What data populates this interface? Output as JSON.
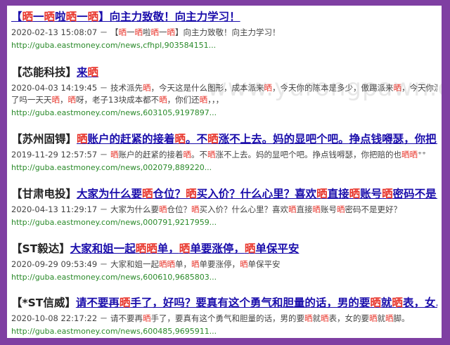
{
  "watermark": "www.yurongpawn.com",
  "results": [
    {
      "tag": "",
      "title": [
        [
          "【"
        ],
        [
          "晒",
          1
        ],
        [
          "一"
        ],
        [
          "晒",
          1
        ],
        [
          "啦"
        ],
        [
          "晒",
          1
        ],
        [
          "一"
        ],
        [
          "晒",
          1
        ],
        [
          "】向主力致敬！向主力学习！"
        ]
      ],
      "snippet": [
        [
          "2020-02-13 15:08:07 － 【"
        ],
        [
          "晒",
          1
        ],
        [
          "一"
        ],
        [
          "晒",
          1
        ],
        [
          "啦"
        ],
        [
          "晒",
          1
        ],
        [
          "一"
        ],
        [
          "晒",
          1
        ],
        [
          "】向主力致敬！向主力学习！"
        ]
      ],
      "url": "http://guba.eastmoney.com/news,cfhpl,903584151...",
      "title_text": "【晒一晒啦晒一晒】向主力致敬！向主力学习！",
      "snippet_text": "2020-02-13 15:08:07 － 【晒一晒啦晒一晒】向主力致敬！向主力学习！"
    },
    {
      "tag": "【芯能科技】",
      "title": [
        [
          "来"
        ],
        [
          "晒",
          1
        ]
      ],
      "snippet": [
        [
          "2020-04-03 14:19:45 － 技术派先"
        ],
        [
          "晒",
          1
        ],
        [
          "，今天这是什么图形，成本派来"
        ],
        [
          "晒",
          1
        ],
        [
          "，今天你的陈本是多少，傲踢派来"
        ],
        [
          "晒",
          1
        ],
        [
          "，今天你湿"
        ]
      ],
      "snippet2": [
        [
          "了吗一天天"
        ],
        [
          "晒",
          1
        ],
        [
          "，"
        ],
        [
          "晒",
          1
        ],
        [
          "呀，老子13块成本都不"
        ],
        [
          "晒",
          1
        ],
        [
          "，你们还"
        ],
        [
          "晒",
          1
        ],
        [
          "，，，"
        ]
      ],
      "url": "http://guba.eastmoney.com/news,603105,9197897...",
      "title_text": "来晒",
      "snippet_text": "2020-04-03 14:19:45 － 技术派先晒，今天这是什么图形，成本派来晒，今天你的陈本是多少，傲踢派来晒，今天你湿",
      "snippet2_text": "了吗一天天晒，晒呀，老子13块成本都不晒，你们还晒，，，"
    },
    {
      "tag": "【苏州固锝】",
      "title": [
        [
          "晒",
          1
        ],
        [
          "账户的赶紧的接着"
        ],
        [
          "晒",
          1
        ],
        [
          "。不"
        ],
        [
          "晒",
          1
        ],
        [
          "涨不上去。妈的显吧个吧。挣点钱嘚瑟，你把..."
        ]
      ],
      "snippet": [
        [
          "2019-11-29 12:57:57 － "
        ],
        [
          "晒",
          1
        ],
        [
          "账户的赶紧的接着"
        ],
        [
          "晒",
          1
        ],
        [
          "。不"
        ],
        [
          "晒",
          1
        ],
        [
          "涨不上去。妈的显吧个吧。挣点钱嘚瑟，你把赔的也"
        ],
        [
          "晒晒",
          1
        ],
        [
          "⁺⁺"
        ]
      ],
      "url": "http://guba.eastmoney.com/news,002079,889220...",
      "title_text": "晒账户的赶紧的接着晒。不晒涨不上去。妈的显吧个吧。挣点钱嘚瑟，你把...",
      "snippet_text": "2019-11-29 12:57:57 － 晒账户的赶紧的接着晒。不晒涨不上去。妈的显吧个吧。挣点钱嘚瑟，你把赔的也晒晒⁺⁺"
    },
    {
      "tag": "【甘肃电投】",
      "title": [
        [
          "大家为什么要"
        ],
        [
          "晒",
          1
        ],
        [
          "仓位？"
        ],
        [
          "晒",
          1
        ],
        [
          "买入价？什么心里？喜欢"
        ],
        [
          "晒",
          1
        ],
        [
          "直接"
        ],
        [
          "晒",
          1
        ],
        [
          "账号"
        ],
        [
          "晒",
          1
        ],
        [
          "密码不是..."
        ]
      ],
      "snippet": [
        [
          "2020-04-13 11:29:17 － 大家为什么要"
        ],
        [
          "晒",
          1
        ],
        [
          "仓位？"
        ],
        [
          "晒",
          1
        ],
        [
          "买入价？什么心里？喜欢"
        ],
        [
          "晒",
          1
        ],
        [
          "直接"
        ],
        [
          "晒",
          1
        ],
        [
          "账号"
        ],
        [
          "晒",
          1
        ],
        [
          "密码不是更好？"
        ]
      ],
      "url": "http://guba.eastmoney.com/news,000791,9217959...",
      "title_text": "大家为什么要晒仓位？晒买入价？什么心里？喜欢晒直接晒账号晒密码不是...",
      "snippet_text": "2020-04-13 11:29:17 － 大家为什么要晒仓位？晒买入价？什么心里？喜欢晒直接晒账号晒密码不是更好？"
    },
    {
      "tag": "【ST毅达】",
      "title": [
        [
          "大家和姐一起"
        ],
        [
          "晒晒",
          1
        ],
        [
          "单，"
        ],
        [
          "晒",
          1
        ],
        [
          "单要涨停，"
        ],
        [
          "晒",
          1
        ],
        [
          "单保平安"
        ]
      ],
      "snippet": [
        [
          "2020-09-29 09:53:49 － 大家和姐一起"
        ],
        [
          "晒晒",
          1
        ],
        [
          "单，"
        ],
        [
          "晒",
          1
        ],
        [
          "单要涨停，"
        ],
        [
          "晒",
          1
        ],
        [
          "单保平安"
        ]
      ],
      "url": "http://guba.eastmoney.com/news,600610,9685803...",
      "title_text": "大家和姐一起晒晒单，晒单要涨停，晒单保平安",
      "snippet_text": "2020-09-29 09:53:49 － 大家和姐一起晒晒单，晒单要涨停，晒单保平安"
    },
    {
      "tag": "【*ST信威】",
      "title": [
        [
          "请不要再"
        ],
        [
          "晒",
          1
        ],
        [
          "手了，好吗？要真有这个勇气和胆量的话，男的要"
        ],
        [
          "晒",
          1
        ],
        [
          "就"
        ],
        [
          "晒",
          1
        ],
        [
          "表，女..."
        ]
      ],
      "snippet": [
        [
          "2020-10-08 22:17:22 － 请不要再"
        ],
        [
          "晒",
          1
        ],
        [
          "手了，要真有这个勇气和胆量的话，男的要"
        ],
        [
          "晒",
          1
        ],
        [
          "就"
        ],
        [
          "晒",
          1
        ],
        [
          "表，女的要"
        ],
        [
          "晒",
          1
        ],
        [
          "就"
        ],
        [
          "晒",
          1
        ],
        [
          "脚。"
        ]
      ],
      "url": "http://guba.eastmoney.com/news,600485,9695911...",
      "title_text": "请不要再晒手了，好吗？要真有这个勇气和胆量的话，男的要晒就晒表，女...",
      "snippet_text": "2020-10-08 22:17:22 － 请不要再晒手了，要真有这个勇气和胆量的话，男的要晒就晒表，女的要晒就晒脚。"
    }
  ]
}
